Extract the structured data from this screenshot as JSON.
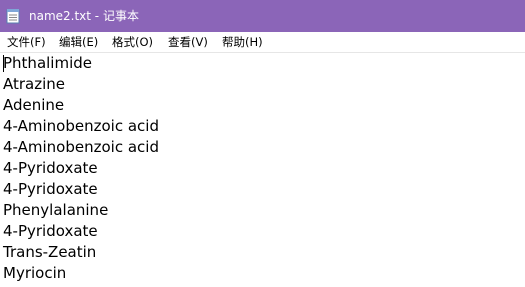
{
  "window": {
    "title": "name2.txt - 记事本",
    "titlebar_color": "#8b65b8",
    "icon": "notepad-icon"
  },
  "menu": [
    {
      "label": "文件(F)"
    },
    {
      "label": "编辑(E)"
    },
    {
      "label": "格式(O)"
    },
    {
      "label": "查看(V)"
    },
    {
      "label": "帮助(H)"
    }
  ],
  "editor": {
    "lines": [
      "Phthalimide",
      "Atrazine",
      "Adenine",
      "4-Aminobenzoic acid",
      "4-Aminobenzoic acid",
      "4-Pyridoxate",
      "4-Pyridoxate",
      "Phenylalanine",
      "4-Pyridoxate",
      "Trans-Zeatin",
      "Myriocin"
    ]
  }
}
